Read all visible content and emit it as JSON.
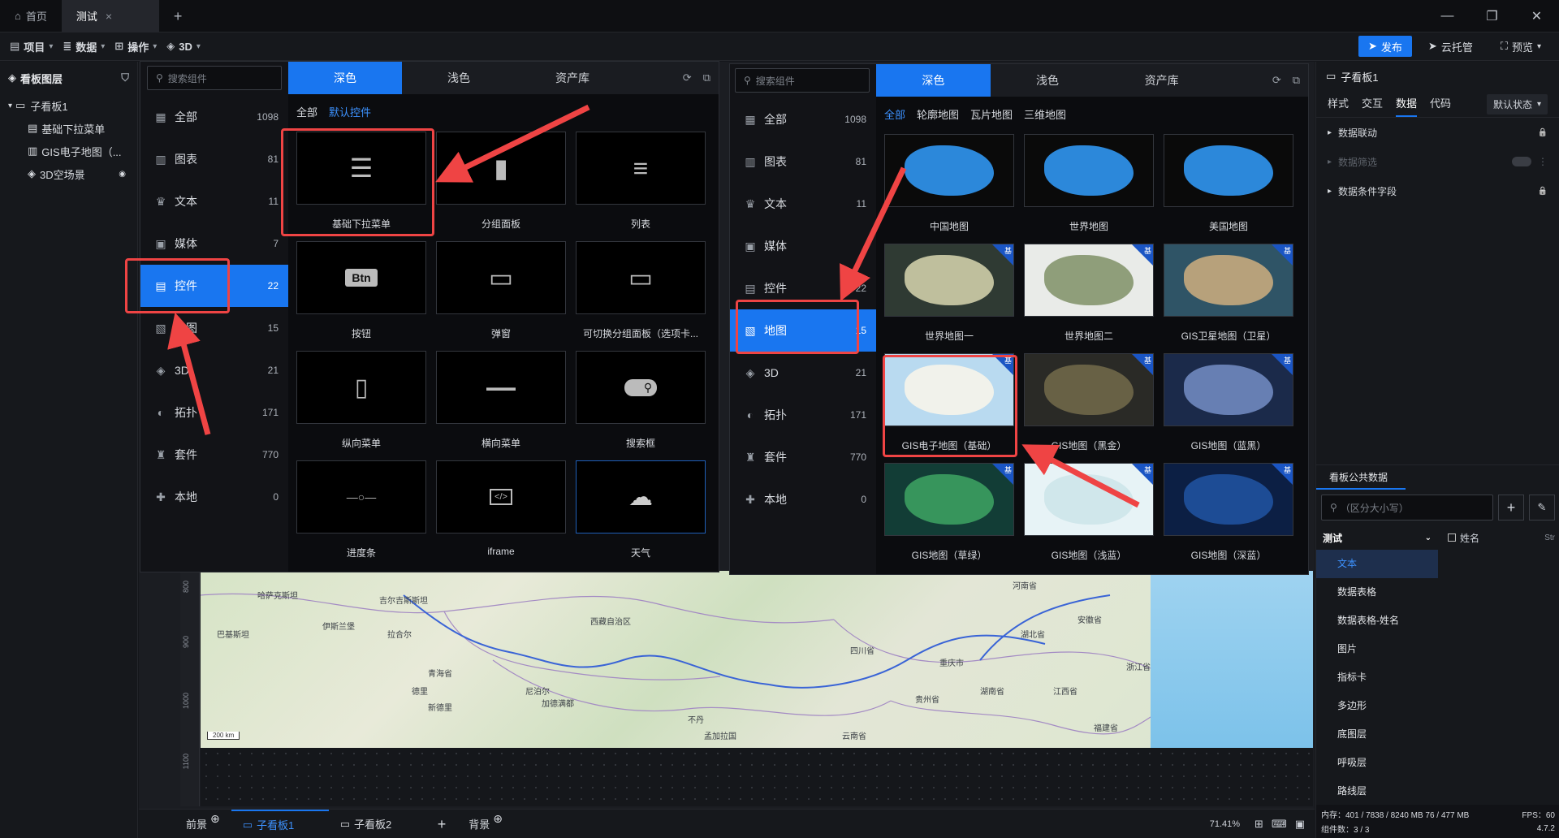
{
  "tabs": {
    "home": "首页",
    "active": "测试",
    "active_close": "×",
    "new": "+"
  },
  "window": {
    "minimize": "—",
    "restore": "❐",
    "close": "✕"
  },
  "toolbar": {
    "menus": [
      {
        "icon": "▤",
        "label": "项目",
        "caret": "▾"
      },
      {
        "icon": "≣",
        "label": "数据",
        "caret": "▾"
      },
      {
        "icon": "⊞",
        "label": "操作",
        "caret": "▾"
      },
      {
        "icon": "◈",
        "label": "3D",
        "caret": "▾"
      }
    ],
    "publish": "发布",
    "cloud": "云托管",
    "preview": "预览",
    "publish_icon": "➤",
    "cloud_icon": "➤",
    "preview_icon": "⛶",
    "preview_caret": "▾"
  },
  "layers": {
    "title": "看板图层",
    "items": [
      {
        "label": "子看板1",
        "icon": "▭",
        "caret": "▾"
      },
      {
        "label": "基础下拉菜单",
        "icon": "▤"
      },
      {
        "label": "GIS电子地图（...",
        "icon": "▥"
      },
      {
        "label": "3D空场景",
        "icon": "◈",
        "eye": "◉"
      }
    ]
  },
  "panel1": {
    "search_placeholder": "搜索组件",
    "tabs": [
      "深色",
      "浅色",
      "资产库"
    ],
    "categories": [
      {
        "label": "全部",
        "count": "1098",
        "icon": "▦"
      },
      {
        "label": "图表",
        "count": "81",
        "icon": "▥"
      },
      {
        "label": "文本",
        "count": "11",
        "icon": "♛"
      },
      {
        "label": "媒体",
        "count": "7",
        "icon": "▣"
      },
      {
        "label": "控件",
        "count": "22",
        "icon": "▤"
      },
      {
        "label": "地图",
        "count": "15",
        "icon": "▧"
      },
      {
        "label": "3D",
        "count": "21",
        "icon": "◈"
      },
      {
        "label": "拓扑",
        "count": "171",
        "icon": "◐"
      },
      {
        "label": "套件",
        "count": "770",
        "icon": "♜"
      },
      {
        "label": "本地",
        "count": "0",
        "icon": "✚"
      }
    ],
    "subfilters": [
      "全部",
      "默认控件"
    ],
    "cards": [
      {
        "label": "基础下拉菜单",
        "glyph": "☰"
      },
      {
        "label": "分组面板",
        "glyph": "▮"
      },
      {
        "label": "列表",
        "glyph": "≡"
      },
      {
        "label": "按钮",
        "glyph": "Btn"
      },
      {
        "label": "弹窗",
        "glyph": "▭"
      },
      {
        "label": "可切换分组面板（选项卡...",
        "glyph": "▭"
      },
      {
        "label": "纵向菜单",
        "glyph": "▯"
      },
      {
        "label": "横向菜单",
        "glyph": "▬▬▬"
      },
      {
        "label": "搜索框",
        "glyph": "⚲"
      },
      {
        "label": "进度条",
        "glyph": "—○—"
      },
      {
        "label": "iframe",
        "glyph": "</>"
      },
      {
        "label": "天气",
        "glyph": "☁"
      }
    ]
  },
  "panel2": {
    "search_placeholder": "搜索组件",
    "tabs": [
      "深色",
      "浅色",
      "资产库"
    ],
    "categories": [
      {
        "label": "全部",
        "count": "1098",
        "icon": "▦"
      },
      {
        "label": "图表",
        "count": "81",
        "icon": "▥"
      },
      {
        "label": "文本",
        "count": "11",
        "icon": "♛"
      },
      {
        "label": "媒体",
        "count": "",
        "icon": "▣"
      },
      {
        "label": "控件",
        "count": "22",
        "icon": "▤"
      },
      {
        "label": "地图",
        "count": "15",
        "icon": "▧"
      },
      {
        "label": "3D",
        "count": "21",
        "icon": "◈"
      },
      {
        "label": "拓扑",
        "count": "171",
        "icon": "◐"
      },
      {
        "label": "套件",
        "count": "770",
        "icon": "♜"
      },
      {
        "label": "本地",
        "count": "0",
        "icon": "✚"
      }
    ],
    "subfilters": [
      "全部",
      "轮廓地图",
      "瓦片地图",
      "三维地图"
    ],
    "badge": "基",
    "cards": [
      {
        "label": "中国地图",
        "color": "#0a0a0a",
        "land": "#2e8fe6"
      },
      {
        "label": "世界地图",
        "color": "#0a0a0a",
        "land": "#2e8fe6"
      },
      {
        "label": "美国地图",
        "color": "#0a0a0a",
        "land": "#2e8fe6"
      },
      {
        "label": "世界地图一",
        "color": "#2f3a33",
        "land": "#c7c6a3"
      },
      {
        "label": "世界地图二",
        "color": "#e9ebe8",
        "land": "#8a9a74"
      },
      {
        "label": "GIS卫星地图（卫星）",
        "color": "#2f5466",
        "land": "#bfa57c"
      },
      {
        "label": "GIS电子地图（基础）",
        "color": "#b9daf0",
        "land": "#f3f3ea"
      },
      {
        "label": "GIS地图（黑金）",
        "color": "#2a2a26",
        "land": "#6b6447"
      },
      {
        "label": "GIS地图（蓝黑）",
        "color": "#1b2a4a",
        "land": "#6c84b8"
      },
      {
        "label": "GIS地图（草绿）",
        "color": "#123d36",
        "land": "#3a9a5f"
      },
      {
        "label": "GIS地图（浅蓝）",
        "color": "#e7f3f6",
        "land": "#cfe6ea"
      },
      {
        "label": "GIS地图（深蓝）",
        "color": "#0c1f44",
        "land": "#1f4f9a"
      }
    ]
  },
  "props": {
    "title": "子看板1",
    "tabs": [
      "样式",
      "交互",
      "数据",
      "代码"
    ],
    "state": "默认状态",
    "rows": [
      {
        "label": "数据联动",
        "icon": "🔒",
        "arrow": "▸"
      },
      {
        "label": "数据筛选",
        "icon": "⋮",
        "arrow": "▸"
      },
      {
        "label": "数据条件字段",
        "icon": "🔒",
        "arrow": "▸"
      }
    ],
    "public_title": "看板公共数据",
    "search_placeholder": "（区分大小写）",
    "plus": "+",
    "edit": "✎",
    "dataset": "测试",
    "field": "姓名",
    "field_type": "Str",
    "list": [
      "文本",
      "数据表格",
      "数据表格-姓名",
      "图片",
      "指标卡",
      "多边形",
      "底图层",
      "呼吸层",
      "路线层"
    ],
    "status_mem": "内存：401 / 7838 / 8240 MB  76 / 477 MB",
    "status_fps": "FPS：60",
    "status_count": "组件数：3 / 3",
    "version": "4.7.2"
  },
  "bottom": {
    "front": "前景",
    "board1": "子看板1",
    "board2": "子看板2",
    "add": "+",
    "back": "背景",
    "zoom": "71.41%",
    "board_icon": "▭",
    "add_icon": "⊕"
  },
  "ruler": {
    "ticks": [
      "800",
      "900",
      "1000",
      "1100"
    ]
  },
  "map": {
    "labels": [
      "哈萨克斯坦",
      "吉尔吉斯斯坦",
      "拉合尔",
      "德里",
      "新德里",
      "青海省",
      "西藏自治区",
      "四川省",
      "湖北省",
      "安徽省",
      "河南省",
      "贵州省",
      "浙江省",
      "江西省",
      "福建省",
      "云南省",
      "湖南省",
      "重庆市",
      "巴基斯坦",
      "伊斯兰堡",
      "尼泊尔",
      "加德满都",
      "不丹",
      "孟加拉国"
    ],
    "scale": "200 km"
  }
}
